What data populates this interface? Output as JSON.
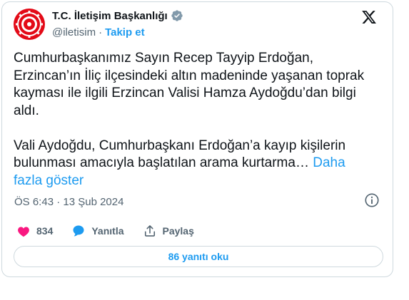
{
  "account": {
    "name": "T.C. İletişim Başkanlığı",
    "handle": "@iletisim",
    "separator": "·",
    "follow_label": "Takip et"
  },
  "tweet": {
    "paragraph1": "Cumhurbaşkanımız Sayın Recep Tayyip Erdoğan,\nErzincan’ın İliç ilçesindeki altın madeninde yaşanan toprak\nkayması ile ilgili Erzincan Valisi Hamza Aydoğdu’dan bilgi\naldı.",
    "paragraph2": "Vali Aydoğdu, Cumhurbaşkanı Erdoğan’a kayıp kişilerin\nbulunması amacıyla başlatılan arama kurtarma… ",
    "show_more": "Daha\nfazla göster",
    "timestamp": "ÖS 6:43 · 13 Şub 2024"
  },
  "actions": {
    "likes": "834",
    "reply_label": "Yanıtla",
    "share_label": "Paylaş"
  },
  "replies_button": "86 yanıtı oku",
  "colors": {
    "accent": "#1d9bf0",
    "like": "#f91880",
    "avatar_red": "#e30a17"
  }
}
